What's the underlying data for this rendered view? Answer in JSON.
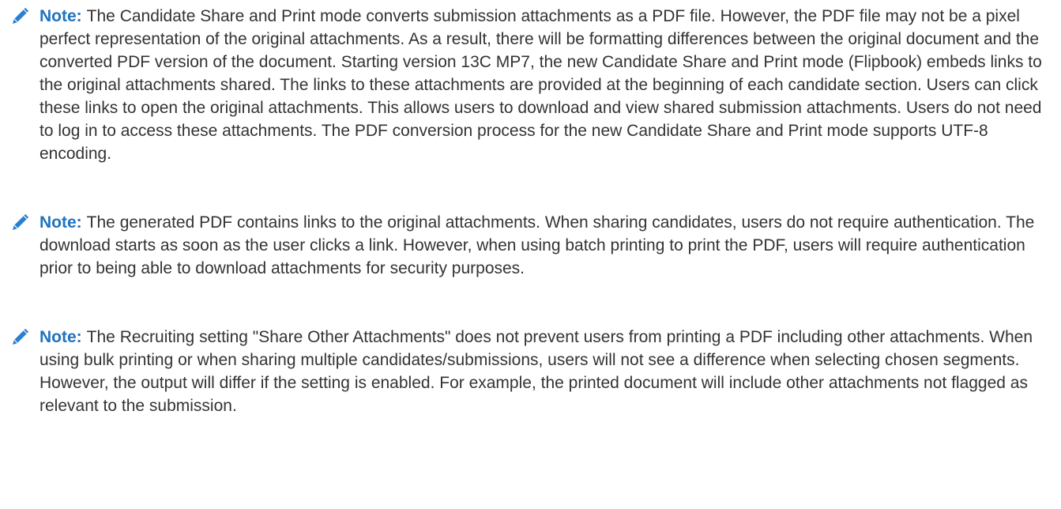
{
  "notes": [
    {
      "icon": "pencil-icon",
      "label": "Note:",
      "text": "The Candidate Share and Print mode converts submission attachments as a PDF file. However, the PDF file may not be a pixel perfect representation of the original attachments. As a result, there will be formatting differences between the original document and the converted PDF version of the document. Starting version 13C MP7, the new Candidate Share and Print mode (Flipbook) embeds links to the original attachments shared. The links to these attachments are provided at the beginning of each candidate section. Users can click these links to open the original attachments. This allows users to download and view shared submission attachments. Users do not need to log in to access these attachments. The PDF conversion process for the new Candidate Share and Print mode supports UTF-8 encoding."
    },
    {
      "icon": "pencil-icon",
      "label": "Note:",
      "text": "The generated PDF contains links to the original attachments. When sharing candidates, users do not require authentication. The download starts as soon as the user clicks a link. However, when using batch printing to print the PDF, users will require authentication prior to being able to download attachments for security purposes."
    },
    {
      "icon": "pencil-icon",
      "label": "Note:",
      "text": "The Recruiting setting \"Share Other Attachments\" does not prevent users from printing a PDF including other attachments. When using bulk printing or when sharing multiple candidates/submissions, users will not see a difference when selecting chosen segments. However, the output will differ if the setting is enabled. For example, the printed document will include other attachments not flagged as relevant to the submission."
    }
  ],
  "colors": {
    "label": "#1f73bf",
    "text": "#333333",
    "icon": "#2a7fd0"
  }
}
